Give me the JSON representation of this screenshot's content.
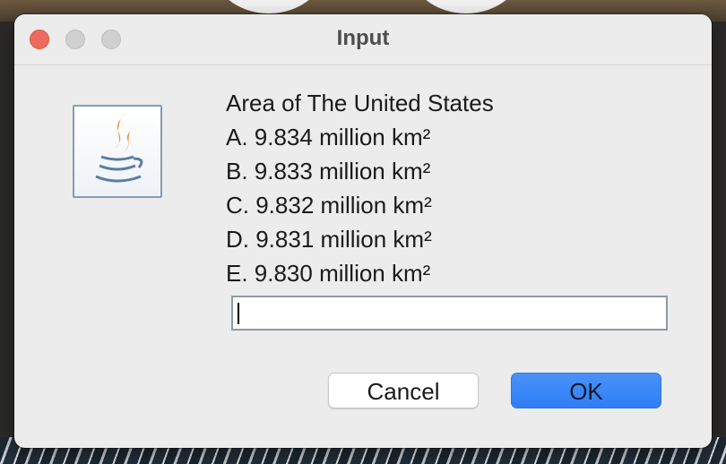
{
  "window": {
    "title": "Input",
    "icon": "java-coffee-cup-icon"
  },
  "message": {
    "question": "Area of The United States",
    "options": [
      "A. 9.834 million km²",
      "B. 9.833 million km²",
      "C. 9.832 million km²",
      "D. 9.831 million km²",
      "E. 9.830 million km²"
    ]
  },
  "input": {
    "value": ""
  },
  "buttons": {
    "cancel_label": "Cancel",
    "ok_label": "OK"
  },
  "colors": {
    "close": "#ed6a5e",
    "accent": "#3b86f8",
    "dialog_bg": "#ececec"
  }
}
